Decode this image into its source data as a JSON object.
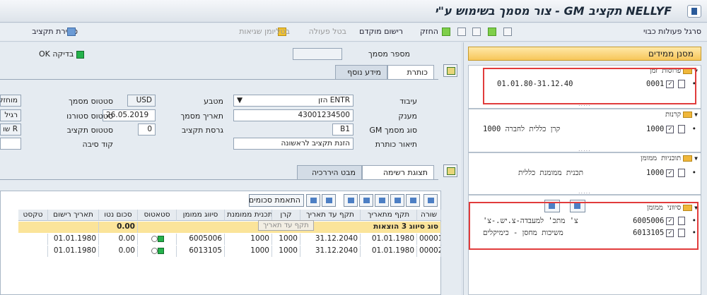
{
  "window": {
    "title": "NELLYF תקציב GM - צור מסמך בשימוש ע\"י"
  },
  "toolbar": {
    "items": [
      {
        "label": "סרגל פעולות כבוי",
        "icon": "document-icon",
        "disabled": false
      },
      {
        "label": "החזק",
        "icon": "hold-icon",
        "disabled": false
      },
      {
        "label": "רישום מוקדם",
        "icon": "",
        "disabled": false
      },
      {
        "label": "בטל פעולה",
        "icon": "",
        "disabled": true
      },
      {
        "label": "בטל",
        "icon": "",
        "disabled": true
      },
      {
        "label": "יומן שגיאות",
        "icon": "log-icon",
        "disabled": true
      },
      {
        "label": "סקירת תקציב",
        "icon": "overview-icon",
        "disabled": false
      }
    ]
  },
  "right_panel": {
    "selected_button": "מסנן ממידים",
    "groups": [
      {
        "name": "פרוסות זמן",
        "rows": [
          {
            "code": "0001",
            "text": "01.01.80-31.12.40"
          }
        ]
      },
      {
        "name": "קרנות",
        "rows": [
          {
            "code": "1000",
            "text": "קרן כללית לחברה 1000"
          }
        ]
      },
      {
        "name": "תוכניות ממומן",
        "rows": [
          {
            "code": "1000",
            "text": "תכנית ממומנת כללית"
          }
        ]
      },
      {
        "name": "סיווני ממומן",
        "rows": [
          {
            "code": "6005006",
            "text": "צ' מתכ' למעבדה-צ.יש.-צ'"
          },
          {
            "code": "6013105",
            "text": "משיכות מחסן - כימיקלים"
          }
        ]
      }
    ]
  },
  "header": {
    "doc_number_label": "מספר מסמך",
    "doc_number_value": "",
    "check_label": "בדיקה OK",
    "tabs": [
      {
        "label": "כותרת",
        "active": true
      },
      {
        "label": "מידע נוסף",
        "active": false
      }
    ],
    "fields": {
      "processing_label": "עיבוד",
      "processing_value": "ENTR הזן",
      "currency_label": "מטבע",
      "currency_value": "USD",
      "doc_status_label": "סטטוס מסמך",
      "doc_status_value": "מוחזק",
      "grantor_label": "מענק",
      "grantor_value": "43001234500",
      "doc_date_label": "תאריך מסמך",
      "doc_date_value": "26.05.2019",
      "reversal_status_label": "סטטוס סטורנו",
      "reversal_status_value": "רגיל",
      "gm_doc_type_label": "סוג מסמך GM",
      "gm_doc_type_value": "B1",
      "budget_version_label": "גרסת תקציב",
      "budget_version_value": "0",
      "budget_status_label": "סטטוס תקציב",
      "budget_status_value": "R שו",
      "header_desc_label": "תיאור כותרת",
      "header_desc_value": "הזנת תקציב לראשונה",
      "reason_code_label": "קוד סיבה",
      "reason_code_value": ""
    }
  },
  "grid": {
    "tabs": [
      {
        "label": "תצוגת רשימה",
        "active": true
      },
      {
        "label": "מבט היררכיה",
        "active": false
      }
    ],
    "sum_button": "התאמת סכומים",
    "columns": [
      "שורה",
      "תקף מתאריך",
      "תקף עד תאריך",
      "קרן",
      "תכנית ממומנת",
      "סיווג ממומן",
      "סטאטוס",
      "סכום נטו",
      "תאריך רישום",
      "טקסט"
    ],
    "summary": {
      "label": "סוג סיווג 3 הוצאות",
      "amount": "0.00"
    },
    "rows": [
      {
        "line": "000010",
        "from": "01.01.1980",
        "to": "31.12.2040",
        "fund": "1000",
        "program": "1000",
        "class": "6005006",
        "amount": "0.00",
        "post_date": "01.01.1980",
        "text": ""
      },
      {
        "line": "000020",
        "from": "01.01.1980",
        "to": "31.12.2040",
        "fund": "1000",
        "program": "1000",
        "class": "6013105",
        "amount": "0.00",
        "post_date": "01.01.1980",
        "text": ""
      }
    ],
    "tooltip": "תקף עד תאריך"
  }
}
